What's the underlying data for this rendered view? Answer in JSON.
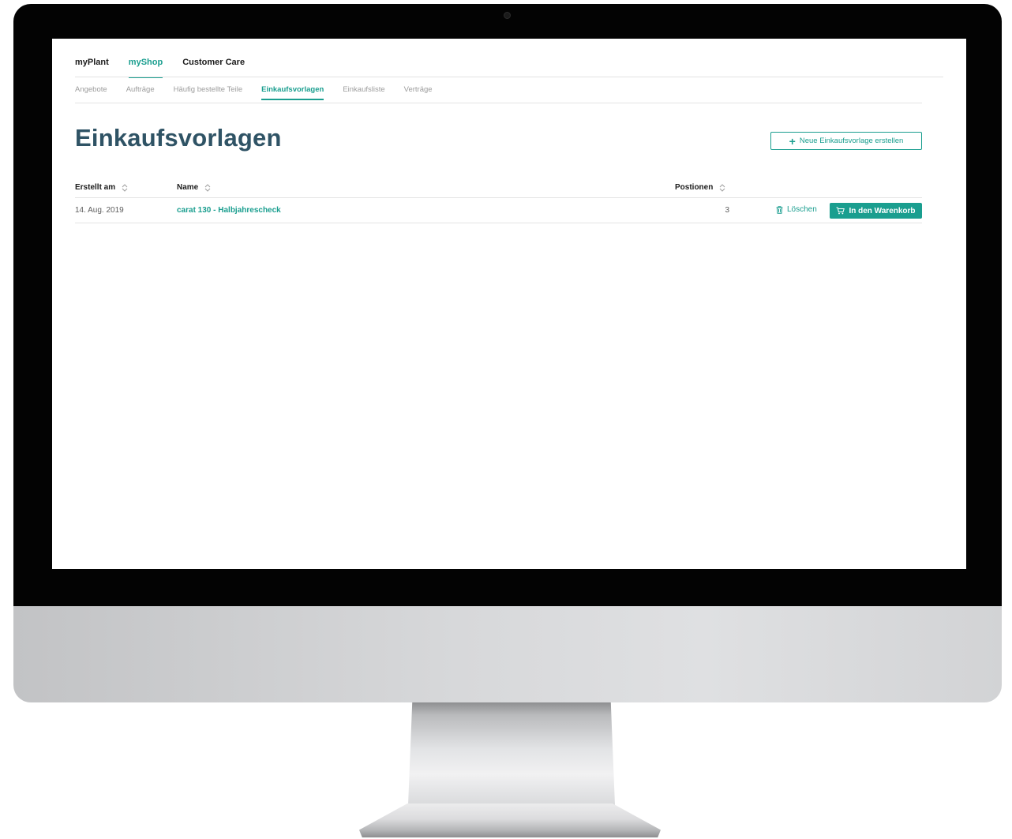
{
  "top_nav": {
    "items": [
      {
        "label": "myPlant",
        "active": false
      },
      {
        "label": "myShop",
        "active": true
      },
      {
        "label": "Customer Care",
        "active": false
      }
    ]
  },
  "sub_nav": {
    "items": [
      {
        "label": "Angebote",
        "active": false
      },
      {
        "label": "Aufträge",
        "active": false
      },
      {
        "label": "Häufig bestellte Teile",
        "active": false
      },
      {
        "label": "Einkaufsvorlagen",
        "active": true
      },
      {
        "label": "Einkaufsliste",
        "active": false
      },
      {
        "label": "Verträge",
        "active": false
      }
    ]
  },
  "page": {
    "title": "Einkaufsvorlagen",
    "new_button_label": "Neue Einkaufsvorlage erstellen",
    "new_button_icon": "plus-icon"
  },
  "table": {
    "columns": {
      "created": "Erstellt am",
      "name": "Name",
      "positions": "Postionen"
    },
    "sort_icon": "sort-icon",
    "rows": [
      {
        "created": "14. Aug. 2019",
        "name": "carat 130 - Halbjahrescheck",
        "positions": "3",
        "delete_label": "Löschen",
        "delete_icon": "trash-icon",
        "cart_label": "In den Warenkorb",
        "cart_icon": "cart-icon"
      }
    ]
  },
  "colors": {
    "accent": "#1a9e8f",
    "title": "#2f5365",
    "muted": "#9c9c9c",
    "divider": "#e3e3e3"
  }
}
